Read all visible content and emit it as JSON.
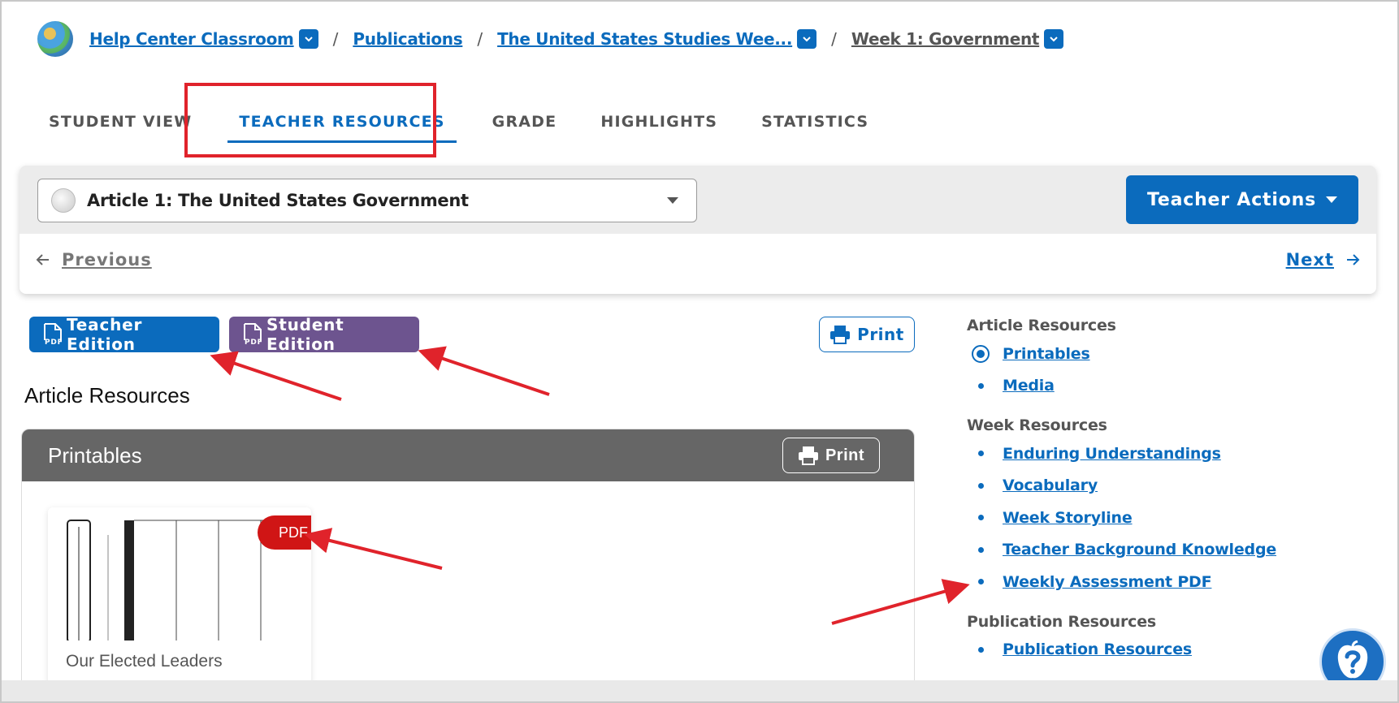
{
  "breadcrumb": {
    "items": [
      {
        "label": "Help Center Classroom"
      },
      {
        "label": "Publications"
      },
      {
        "label": "The United States Studies Wee..."
      },
      {
        "label": "Week 1: Government"
      }
    ],
    "separator": "/"
  },
  "tabs": [
    {
      "label": "STUDENT VIEW"
    },
    {
      "label": "TEACHER RESOURCES",
      "active": true
    },
    {
      "label": "GRADE"
    },
    {
      "label": "HIGHLIGHTS"
    },
    {
      "label": "STATISTICS"
    }
  ],
  "article": {
    "selected": "Article 1: The United States Government",
    "teacher_actions": "Teacher Actions",
    "previous": "Previous",
    "next": "Next"
  },
  "toolbar": {
    "teacher_edition": "Teacher Edition",
    "student_edition": "Student Edition",
    "pdf_icon_text": "PDF",
    "print": "Print"
  },
  "main": {
    "section_title": "Article Resources",
    "printables": {
      "title": "Printables",
      "print": "Print",
      "items": [
        {
          "label": "Our Elected Leaders",
          "badge": "PDF"
        }
      ]
    }
  },
  "sidebar": {
    "groups": [
      {
        "heading": "Article Resources",
        "links": [
          "Printables",
          "Media"
        ]
      },
      {
        "heading": "Week Resources",
        "links": [
          "Enduring Understandings",
          "Vocabulary",
          "Week Storyline",
          "Teacher Background Knowledge",
          "Weekly Assessment PDF"
        ]
      },
      {
        "heading": "Publication Resources",
        "links": [
          "Publication Resources"
        ]
      }
    ]
  },
  "colors": {
    "primary": "#0b6bbd",
    "student_purple": "#6d548f",
    "annotation_red": "#e0232b",
    "pdf_badge": "#d01515",
    "header_gray": "#666666"
  },
  "icons": [
    "globe-icon",
    "chevron-down-icon",
    "arrow-left-icon",
    "arrow-right-icon",
    "pdf-file-icon",
    "printer-icon",
    "help-icon"
  ]
}
